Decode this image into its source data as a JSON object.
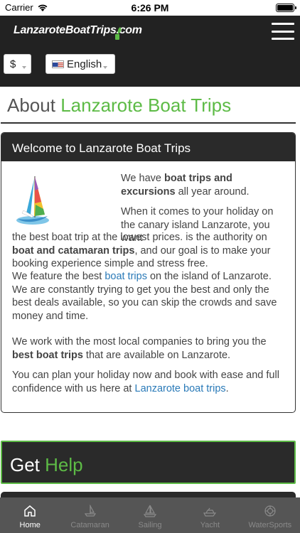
{
  "status_bar": {
    "carrier": "Carrier",
    "time": "6:26 PM"
  },
  "header": {
    "logo": "LanzaroteBoatTrips.com"
  },
  "selectors": {
    "currency": "$",
    "language": "English"
  },
  "about": {
    "title_prefix": "About",
    "title_accent": "Lanzarote Boat Trips"
  },
  "welcome_card": {
    "heading": "Welcome to Lanzarote Boat Trips",
    "p1_a": "We have ",
    "p1_b": "boat trips and excursions",
    "p1_c": " all year around.",
    "p2_a": "When it comes to your holiday on the canary island Lanzarote, you want",
    "p2b_a": "the best boat trip at the lowest prices. is the authority on ",
    "p2b_b": "boat and catamaran trips",
    "p2b_c": ", and our goal is to make your booking experience simple and stress free.",
    "p3_a": "We feature the best ",
    "p3_link": "boat trips",
    "p3_b": " on the island of Lanzarote. We are constantly trying to get you the best and only the best deals available, so you can skip the crowds and save money and time.",
    "p4_a": "We work with the most local companies to bring you the ",
    "p4_b": "best boat trips",
    "p4_c": " that are available on Lanzarote.",
    "p5_a": "You can plan your holiday now and book with ease and full confidence with us here at ",
    "p5_link": "Lanzarote boat trips",
    "p5_b": "."
  },
  "help": {
    "title_prefix": "Get",
    "title_accent": "Help"
  },
  "tabs": [
    {
      "label": "Home",
      "icon": "home-icon",
      "active": true
    },
    {
      "label": "Catamaran",
      "icon": "catamaran-icon",
      "active": false
    },
    {
      "label": "Sailing",
      "icon": "sailing-icon",
      "active": false
    },
    {
      "label": "Yacht",
      "icon": "yacht-icon",
      "active": false
    },
    {
      "label": "WaterSports",
      "icon": "watersports-icon",
      "active": false
    }
  ],
  "colors": {
    "accent": "#5dbb46",
    "header_bg": "#222222",
    "tab_bar_bg": "#555555",
    "link": "#2a7ab8"
  }
}
